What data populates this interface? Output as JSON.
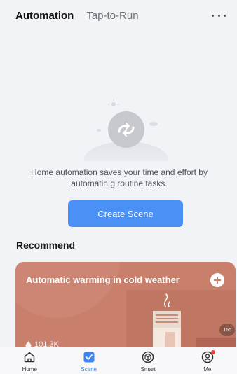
{
  "tabs": {
    "automation": "Automation",
    "tap_to_run": "Tap-to-Run"
  },
  "header": {
    "more_icon": "more-horizontal-icon"
  },
  "empty_state": {
    "illustration_icon": "automation-refresh-icon",
    "message": "Home automation saves your time and effort by automatin g routine tasks."
  },
  "create_button": {
    "label": "Create Scene"
  },
  "recommend": {
    "title": "Recommend",
    "card": {
      "title": "Automatic warming in cold weather",
      "likes": "101.3K",
      "temperature": "16c",
      "accent_color": "#c87f6c"
    }
  },
  "bottom_nav": {
    "items": [
      {
        "label": "Home",
        "icon": "home-icon",
        "active": false
      },
      {
        "label": "Scene",
        "icon": "scene-checkbox-icon",
        "active": true
      },
      {
        "label": "Smart",
        "icon": "smart-cube-icon",
        "active": false
      },
      {
        "label": "Me",
        "icon": "user-icon",
        "active": false,
        "badge": true
      }
    ]
  },
  "colors": {
    "primary": "#4a90f5",
    "background": "#f2f3f7",
    "nav_active": "#3b84f0"
  }
}
